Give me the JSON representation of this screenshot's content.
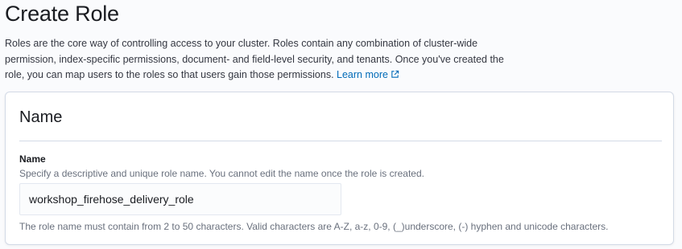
{
  "page": {
    "title": "Create Role",
    "description": "Roles are the core way of controlling access to your cluster. Roles contain any combination of cluster-wide permission, index-specific permissions, document- and field-level security, and tenants. Once you've created the role, you can map users to the roles so that users gain those permissions.",
    "learn_more_label": "Learn more",
    "learn_more_icon": "external-link-icon"
  },
  "name_panel": {
    "title": "Name",
    "field_label": "Name",
    "field_help": "Specify a descriptive and unique role name. You cannot edit the name once the role is created.",
    "input_value": "workshop_firehose_delivery_role",
    "validation_text": "The role name must contain from 2 to 50 characters. Valid characters are A-Z, a-z, 0-9, (_)underscore, (-) hyphen and unicode characters."
  },
  "colors": {
    "link": "#006bb8",
    "text": "#343741",
    "subdued": "#69707d",
    "border": "#d3dae6"
  }
}
